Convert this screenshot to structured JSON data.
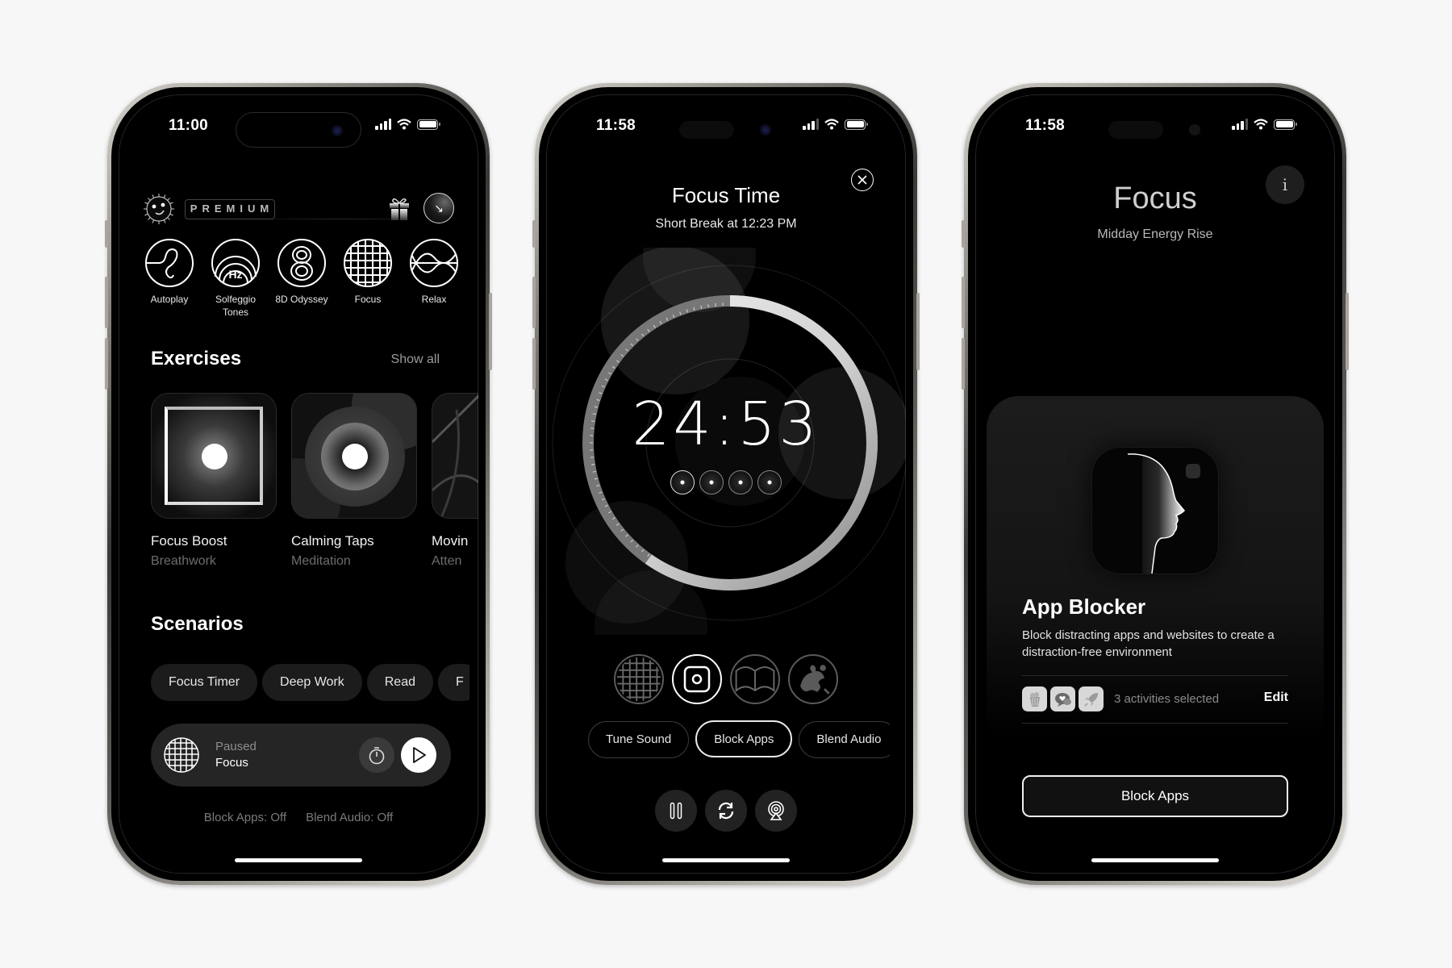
{
  "phones": [
    {
      "status": {
        "time": "11:00"
      },
      "header": {
        "badge": "PREMIUM",
        "logo_icon": "sun-face-icon",
        "gift_icon": "gift-icon",
        "profile_icon": "profile-arrow-icon"
      },
      "modes": [
        {
          "label": "Autoplay",
          "icon": "autoplay-icon"
        },
        {
          "label": "Solfeggio Tones",
          "icon": "hz-waves-icon"
        },
        {
          "label": "8D Odyssey",
          "icon": "eight-icon"
        },
        {
          "label": "Focus",
          "icon": "grid-globe-icon"
        },
        {
          "label": "Relax",
          "icon": "wave-icon"
        }
      ],
      "exercises": {
        "title": "Exercises",
        "show_all": "Show all",
        "items": [
          {
            "name": "Focus Boost",
            "category": "Breathwork"
          },
          {
            "name": "Calming Taps",
            "category": "Meditation"
          },
          {
            "name": "Movin",
            "category": "Atten"
          }
        ]
      },
      "scenarios": {
        "title": "Scenarios",
        "chips": [
          "Focus Timer",
          "Deep Work",
          "Read",
          "F"
        ]
      },
      "player": {
        "state": "Paused",
        "mode": "Focus"
      },
      "toggles": {
        "block_apps": "Block Apps: Off",
        "blend_audio": "Blend Audio: Off"
      }
    },
    {
      "status": {
        "time": "11:58"
      },
      "title": "Focus Time",
      "subtitle": "Short Break at 12:23 PM",
      "timer": {
        "remaining": "24:53",
        "sessions_total": 4,
        "sessions_done": 1
      },
      "scenes": [
        {
          "icon": "grid-globe-icon",
          "active": false
        },
        {
          "icon": "dot-square-icon",
          "active": true
        },
        {
          "icon": "book-icon",
          "active": false
        },
        {
          "icon": "dragon-icon",
          "active": false
        }
      ],
      "options": [
        {
          "label": "Tune Sound",
          "active": false
        },
        {
          "label": "Block Apps",
          "active": true
        },
        {
          "label": "Blend Audio",
          "active": false
        }
      ],
      "controls": [
        "pause-icon",
        "repeat-icon",
        "airplay-icon"
      ]
    },
    {
      "status": {
        "time": "11:58"
      },
      "title": "Focus",
      "subtitle": "Midday Energy Rise",
      "info_label": "i",
      "blocker": {
        "title": "App Blocker",
        "description": "Block distracting apps and websites to create a distraction-free environment",
        "activities_text": "3 activities selected",
        "activity_icons": [
          "popcorn-icon",
          "chat-heart-icon",
          "rocket-icon"
        ],
        "edit_label": "Edit",
        "button_label": "Block Apps"
      }
    }
  ],
  "colors": {
    "background": "#f7f7f8",
    "screen": "#000000",
    "surface": "#252525",
    "muted_text": "#8d8d8d"
  }
}
